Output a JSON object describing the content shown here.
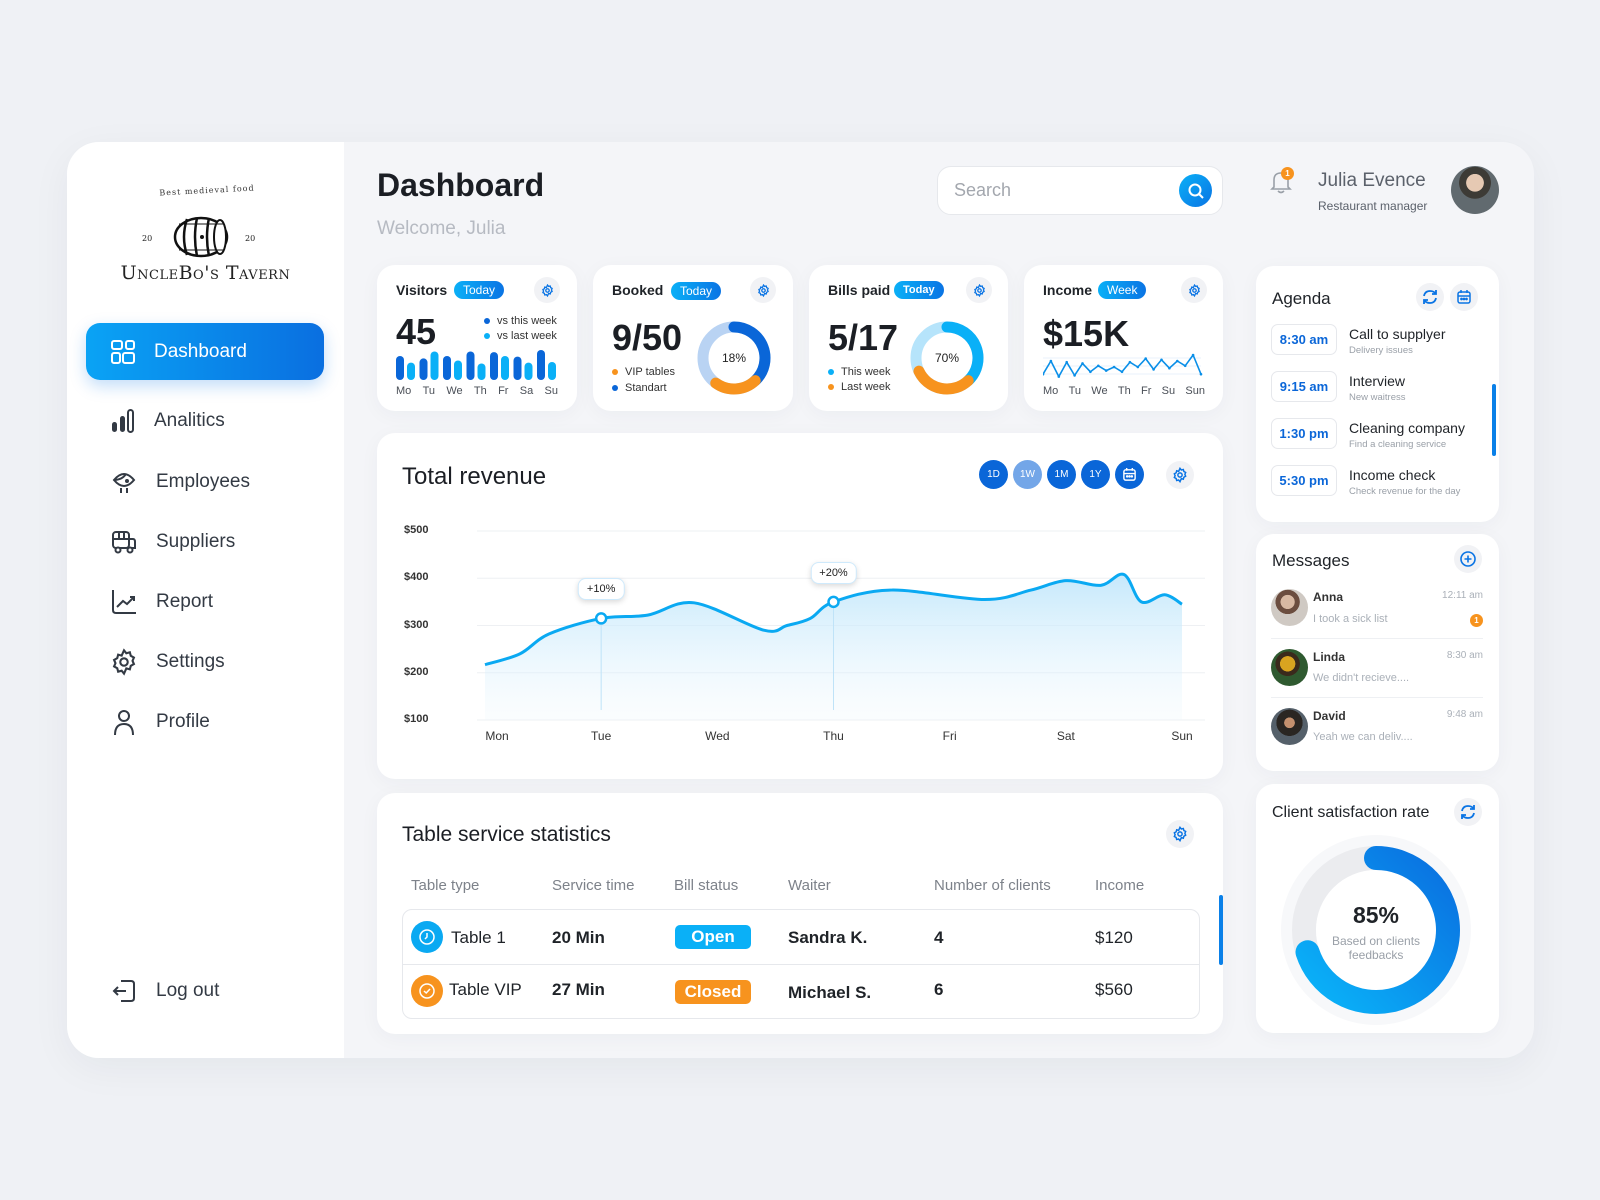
{
  "brand": {
    "tagline": "Best medieval food",
    "year_left": "20",
    "year_right": "20",
    "name": "UncleBo's Tavern"
  },
  "sidebar": {
    "active": {
      "label": "Dashboard",
      "icon": "dashboard-icon"
    },
    "items": [
      {
        "label": "Analitics",
        "icon": "bar-chart-icon"
      },
      {
        "label": "Employees",
        "icon": "chick-icon"
      },
      {
        "label": "Suppliers",
        "icon": "truck-icon"
      },
      {
        "label": "Report",
        "icon": "trend-chart-icon"
      },
      {
        "label": "Settings",
        "icon": "gear-icon"
      },
      {
        "label": "Profile",
        "icon": "user-icon"
      }
    ],
    "logout": {
      "label": "Log out",
      "icon": "logout-icon"
    }
  },
  "header": {
    "title": "Dashboard",
    "welcome": "Welcome, Julia",
    "search_placeholder": "Search",
    "notifications_count": "1",
    "user_name": "Julia Evence",
    "user_role": "Restaurant manager"
  },
  "stats": {
    "visitors": {
      "title": "Visitors",
      "period": "Today",
      "value": "45",
      "legend": [
        "vs this week",
        "vs last week"
      ],
      "days": [
        "Mo",
        "Tu",
        "We",
        "Th",
        "Fr",
        "Sa",
        "Su"
      ],
      "this_week": [
        0.8,
        0.72,
        0.8,
        0.95,
        0.93,
        0.78,
        1.0
      ],
      "last_week": [
        0.58,
        0.95,
        0.65,
        0.55,
        0.8,
        0.58,
        0.6
      ]
    },
    "booked": {
      "title": "Booked",
      "period": "Today",
      "value": "9/50",
      "percent_label": "18%",
      "legend": [
        "VIP tables",
        "Standart"
      ],
      "standard_fraction": 0.38,
      "vip_fraction": 0.22
    },
    "bills": {
      "title": "Bills paid",
      "period": "Today",
      "value": "5/17",
      "percent_label": "70%",
      "legend": [
        "This week",
        "Last week"
      ],
      "this_week_fraction": 0.38,
      "last_week_fraction": 0.3
    },
    "income": {
      "title": "Income",
      "period": "Week",
      "value": "$15K",
      "days": [
        "Mo",
        "Tu",
        "We",
        "Th",
        "Fr",
        "Su",
        "Sun"
      ],
      "points": [
        0.2,
        0.75,
        0.1,
        0.7,
        0.15,
        0.65,
        0.3,
        0.55,
        0.35,
        0.5,
        0.3,
        0.7,
        0.5,
        0.85,
        0.4,
        0.8,
        0.45,
        0.75,
        0.55,
        1.0,
        0.2
      ]
    }
  },
  "revenue": {
    "title": "Total revenue",
    "ranges": [
      {
        "label": "1D",
        "active": true
      },
      {
        "label": "1W",
        "active": false
      },
      {
        "label": "1M",
        "active": true
      },
      {
        "label": "1Y",
        "active": true
      }
    ]
  },
  "chart_data": {
    "type": "area",
    "title": "Total revenue",
    "xlabel": "",
    "ylabel": "",
    "categories": [
      "Mon",
      "Tue",
      "Wed",
      "Thu",
      "Fri",
      "Sat",
      "Sun"
    ],
    "yticks": [
      "$500",
      "$400",
      "$300",
      "$200",
      "$100"
    ],
    "ylim": [
      100,
      500
    ],
    "grid": true,
    "series": [
      {
        "name": "Revenue",
        "x": [
          0,
          0.3,
          0.55,
          1.0,
          1.4,
          1.8,
          2.4,
          2.6,
          2.8,
          3.0,
          3.5,
          4.3,
          4.7,
          5.0,
          5.3,
          5.5,
          5.65,
          5.85,
          6.0
        ],
        "values": [
          217,
          240,
          282,
          315,
          322,
          348,
          290,
          300,
          315,
          350,
          375,
          355,
          375,
          395,
          385,
          408,
          350,
          365,
          345
        ]
      }
    ],
    "annotations": [
      {
        "x": 1.0,
        "y": 315,
        "label": "+10%"
      },
      {
        "x": 3.0,
        "y": 350,
        "label": "+20%"
      }
    ]
  },
  "table": {
    "title": "Table service statistics",
    "columns": [
      "Table type",
      "Service time",
      "Bill status",
      "Waiter",
      "Number of clients",
      "Income"
    ],
    "rows": [
      {
        "type": "Table 1",
        "icon": "clock-icon",
        "color": "#0aa9f2",
        "time": "20 Min",
        "status": "Open",
        "status_color": "#0ab0f7",
        "waiter": "Sandra K.",
        "clients": "4",
        "income": "$120"
      },
      {
        "type": "Table VIP",
        "icon": "check-circle-icon",
        "color": "#f7931e",
        "time": "27 Min",
        "status": "Closed",
        "status_color": "#f7931e",
        "waiter": "Michael S.",
        "clients": "6",
        "income": "$560"
      }
    ]
  },
  "agenda": {
    "title": "Agenda",
    "items": [
      {
        "time": "8:30 am",
        "title": "Call to supplyer",
        "subtitle": "Delivery issues"
      },
      {
        "time": "9:15 am",
        "title": "Interview",
        "subtitle": "New waitress"
      },
      {
        "time": "1:30 pm",
        "title": "Cleaning company",
        "subtitle": "Find a cleaning service"
      },
      {
        "time": "5:30 pm",
        "title": "Income check",
        "subtitle": "Check revenue for the day"
      }
    ]
  },
  "messages": {
    "title": "Messages",
    "items": [
      {
        "name": "Anna",
        "text": "I took a sick list",
        "time": "12:11 am",
        "unread": "1"
      },
      {
        "name": "Linda",
        "text": "We didn't recieve....",
        "time": "8:30 am"
      },
      {
        "name": "David",
        "text": "Yeah we can deliv....",
        "time": "9:48 am"
      }
    ]
  },
  "satisfaction": {
    "title": "Client satisfaction rate",
    "value_label": "85%",
    "value": 0.85,
    "caption": "Based on clients feedbacks"
  },
  "colors": {
    "accent": "#0a74e4",
    "accent_light": "#0ab0f7",
    "orange": "#f7931e"
  }
}
